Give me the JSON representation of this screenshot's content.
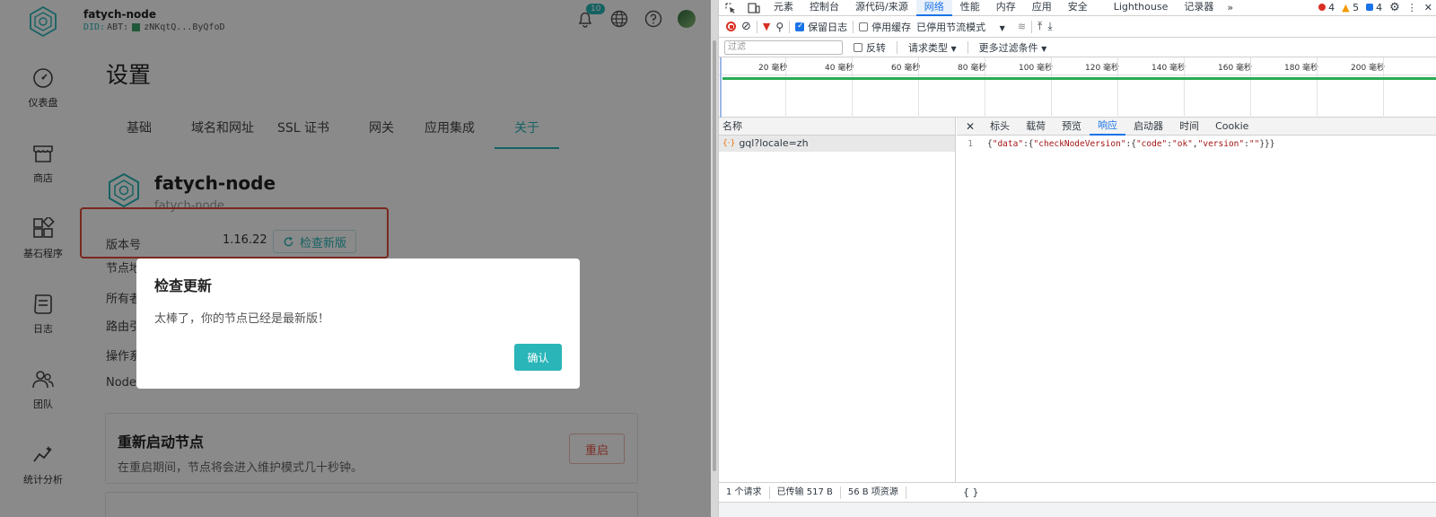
{
  "app": {
    "node_name": "fatych-node",
    "did_prefix": "DID:",
    "did_body": "ABT:",
    "did_suffix": "zNKqtQ...ByQfoD",
    "notification_count": "10",
    "sidebar": [
      {
        "label": "仪表盘",
        "icon": "dashboard-icon"
      },
      {
        "label": "商店",
        "icon": "store-icon"
      },
      {
        "label": "基石程序",
        "icon": "blocklets-icon"
      },
      {
        "label": "日志",
        "icon": "log-icon"
      },
      {
        "label": "团队",
        "icon": "team-icon"
      },
      {
        "label": "统计分析",
        "icon": "analytics-icon"
      }
    ],
    "page_title": "设置",
    "tabs": [
      "基础",
      "域名和网址",
      "SSL 证书",
      "网关",
      "应用集成",
      "关于"
    ],
    "active_tab": "关于",
    "about": {
      "name": "fatych-node",
      "subtitle": "fatych-node",
      "rows": [
        {
          "label": "版本号"
        },
        {
          "label": "节点地"
        },
        {
          "label": "所有者"
        },
        {
          "label": "路由引"
        },
        {
          "label": "操作系"
        },
        {
          "label": "Node."
        }
      ],
      "version": "1.16.22",
      "check_button": "检查新版"
    },
    "restart": {
      "title": "重新启动节点",
      "desc": "在重启期间，节点将会进入维护模式几十秒钟。",
      "button": "重启"
    },
    "dialog": {
      "title": "检查更新",
      "message": "太棒了，你的节点已经是最新版！",
      "ok": "确认"
    },
    "colors": {
      "accent": "#2ab5b8",
      "danger": "#e24b3a"
    }
  },
  "devtools": {
    "tabs": [
      "元素",
      "控制台",
      "源代码/来源",
      "网络",
      "性能",
      "内存",
      "应用",
      "安全",
      "Lighthouse",
      "记录器"
    ],
    "active_tab": "网络",
    "errors": "4",
    "warnings": "5",
    "messages": "4",
    "toolbar": {
      "preserve_log": "保留日志",
      "disable_cache": "停用缓存",
      "throttle": "已停用节流模式"
    },
    "filter": {
      "placeholder": "过滤",
      "invert": "反转",
      "request_type": "请求类型",
      "more_filters": "更多过滤条件"
    },
    "timeline_labels": [
      "20 毫秒",
      "40 毫秒",
      "60 毫秒",
      "80 毫秒",
      "100 毫秒",
      "120 毫秒",
      "140 毫秒",
      "160 毫秒",
      "180 毫秒",
      "200 毫秒"
    ],
    "name_header": "名称",
    "request": "gql?locale=zh",
    "detail_tabs": [
      "标头",
      "载荷",
      "预览",
      "响应",
      "启动器",
      "时间",
      "Cookie"
    ],
    "active_detail_tab": "响应",
    "response": {
      "line_no": "1",
      "body": "{\"data\":{\"checkNodeVersion\":{\"code\":\"ok\",\"version\":\"\"}}}"
    },
    "status": {
      "requests": "1 个请求",
      "transferred": "已传输 517 B",
      "resources": "56 B 项资源",
      "format": "{ }"
    }
  }
}
